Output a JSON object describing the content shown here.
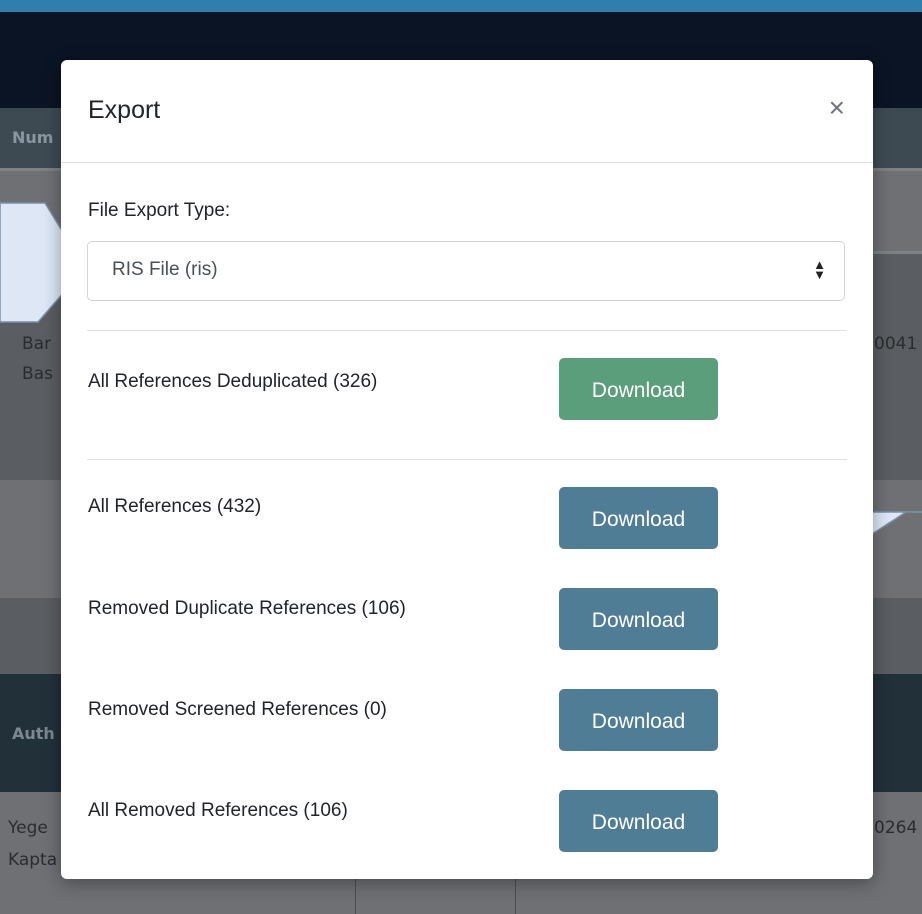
{
  "background": {
    "header_partial": "Num",
    "row1": {
      "cell_a_line1": "Bar",
      "cell_a_line2": "Bas",
      "cell_b": "0041"
    },
    "author_header_partial": "Auth",
    "row2": {
      "cell_a_line1": "Yege",
      "cell_a_line2": "Kapta",
      "cell_b": "0264"
    }
  },
  "modal": {
    "title": "Export",
    "close_label": "×",
    "file_export_label": "File Export Type:",
    "file_export_value": "RIS File (ris)",
    "rows": [
      {
        "label": "All References Deduplicated (326)",
        "button": "Download"
      },
      {
        "label": "All References (432)",
        "button": "Download"
      },
      {
        "label": "Removed Duplicate References (106)",
        "button": "Download"
      },
      {
        "label": "Removed Screened References (0)",
        "button": "Download"
      },
      {
        "label": "All Removed References (106)",
        "button": "Download"
      }
    ]
  },
  "colors": {
    "accent_green": "#5a9e7c",
    "accent_blue": "#4f7d95",
    "navbar": "#0b1424",
    "callout_fill": "#dde7f6"
  }
}
